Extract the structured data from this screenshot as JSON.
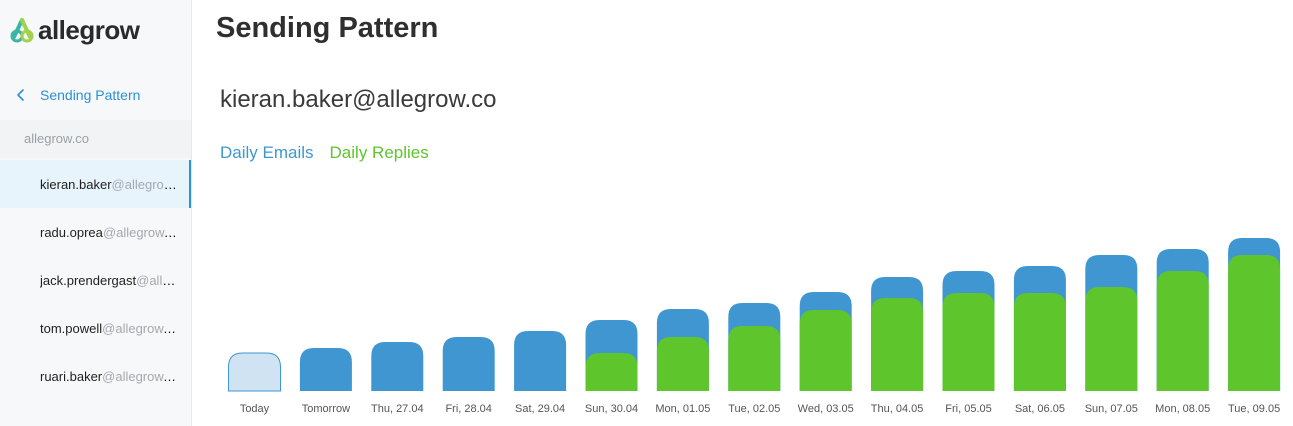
{
  "app": {
    "logo_text": "allegrow"
  },
  "sidebar": {
    "back_label": "Sending Pattern",
    "org": "allegrow.co",
    "users": [
      {
        "name": "kieran.baker",
        "domain": "@allegrow.co",
        "active": true
      },
      {
        "name": "radu.oprea",
        "domain": "@allegrow.co",
        "active": false
      },
      {
        "name": "jack.prendergast",
        "domain": "@allegrow.co",
        "active": false
      },
      {
        "name": "tom.powell",
        "domain": "@allegrow.co",
        "active": false
      },
      {
        "name": "ruari.baker",
        "domain": "@allegrow.co",
        "active": false
      }
    ]
  },
  "main": {
    "title": "Sending Pattern",
    "account": "kieran.baker@allegrow.co",
    "legend": {
      "emails": "Daily Emails",
      "replies": "Daily Replies"
    }
  },
  "colors": {
    "emails": "#3f96d0",
    "replies": "#5ec52c",
    "today_fill": "#cfe3f2",
    "accent": "#2e8fd6"
  },
  "chart_data": {
    "type": "bar",
    "categories": [
      "Today",
      "Tomorrow",
      "Thu, 27.04",
      "Fri, 28.04",
      "Sat, 29.04",
      "Sun, 30.04",
      "Mon, 01.05",
      "Tue, 02.05",
      "Wed, 03.05",
      "Thu, 04.05",
      "Fri, 05.05",
      "Sat, 06.05",
      "Sun, 07.05",
      "Mon, 08.05",
      "Tue, 09.05"
    ],
    "series": [
      {
        "name": "Daily Emails",
        "values": [
          38,
          43,
          49,
          54,
          60,
          71,
          82,
          88,
          99,
          114,
          120,
          125,
          136,
          142,
          153
        ]
      },
      {
        "name": "Daily Replies",
        "values": [
          0,
          0,
          0,
          0,
          0,
          38,
          54,
          65,
          81,
          93,
          98,
          98,
          104,
          120,
          136
        ]
      }
    ],
    "overlap": true,
    "today_highlight": true,
    "ylim": [
      0,
      155
    ],
    "grid": false
  }
}
